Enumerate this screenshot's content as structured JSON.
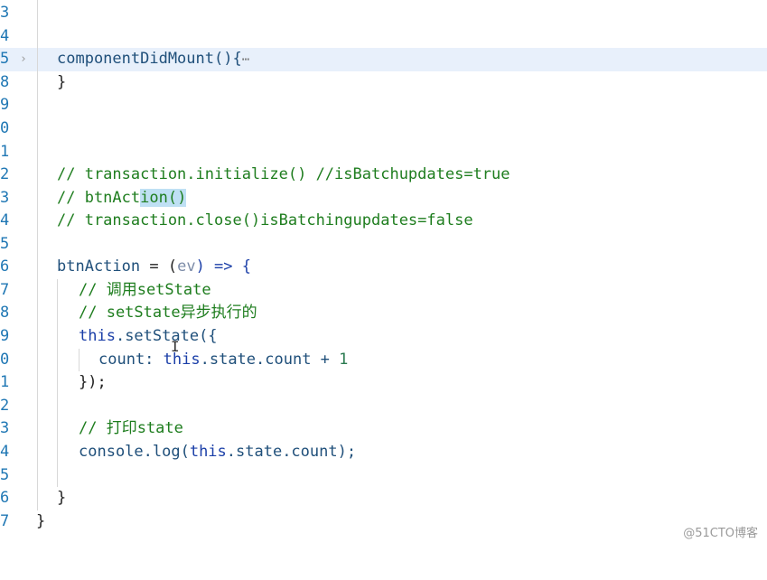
{
  "editor": {
    "lines": [
      {
        "num": "3",
        "text": ""
      },
      {
        "num": "4",
        "text": ""
      },
      {
        "num": "5",
        "fold": "›",
        "text": "componentDidMount(){",
        "ellipsis": "⋯",
        "active": true
      },
      {
        "num": "8",
        "text": "}"
      },
      {
        "num": "9",
        "text": ""
      },
      {
        "num": "0",
        "text": ""
      },
      {
        "num": "1",
        "text": ""
      },
      {
        "num": "2",
        "text": "// transaction.initialize() //isBatchupdates=true"
      },
      {
        "num": "3",
        "text_before": "// btnAct",
        "text_highlight": "ion()",
        "text_after": ""
      },
      {
        "num": "4",
        "text": "// transaction.close()isBatchingupdates=false"
      },
      {
        "num": "5",
        "text": ""
      },
      {
        "num": "6",
        "text_name": "btnAction",
        "text_eq": " = (",
        "text_param": "ev",
        "text_arrow": ") => {"
      },
      {
        "num": "7",
        "text": "// 调用setState"
      },
      {
        "num": "8",
        "text": "// setState异步执行的"
      },
      {
        "num": "9",
        "text_this": "this",
        "text_rest": ".setState({"
      },
      {
        "num": "0",
        "text_key": "count: ",
        "text_this": "this",
        "text_rest": ".state.count + ",
        "text_num": "1"
      },
      {
        "num": "1",
        "text": "});"
      },
      {
        "num": "2",
        "text": ""
      },
      {
        "num": "3",
        "text": "// 打印state"
      },
      {
        "num": "4",
        "text_console": "console.log(",
        "text_this": "this",
        "text_rest": ".state.count);"
      },
      {
        "num": "5",
        "text": ""
      },
      {
        "num": "6",
        "text": "}"
      },
      {
        "num": "7",
        "text": "}"
      }
    ]
  },
  "watermark": "@51CTO博客"
}
